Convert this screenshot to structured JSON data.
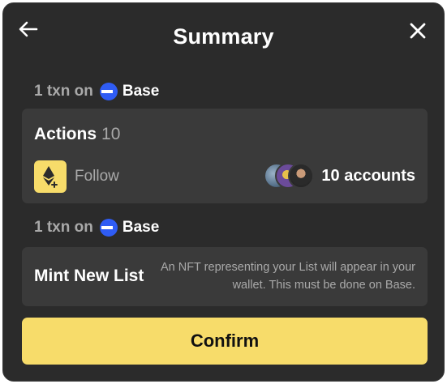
{
  "header": {
    "title": "Summary",
    "back_icon": "arrow-left-icon",
    "close_icon": "close-icon"
  },
  "transactions": [
    {
      "prefix": "1 txn on",
      "chain": "Base",
      "chain_icon": "base-chain-icon",
      "chain_color": "#2f5cf4"
    },
    {
      "prefix": "1 txn on",
      "chain": "Base",
      "chain_icon": "base-chain-icon",
      "chain_color": "#2f5cf4"
    }
  ],
  "actions_card": {
    "title": "Actions",
    "count": "10",
    "action": {
      "label": "Follow",
      "icon": "ethereum-plus-icon",
      "accounts": "10 accounts"
    }
  },
  "mint_card": {
    "title": "Mint New List",
    "description": "An NFT representing your List will appear in your wallet. This must be done on Base."
  },
  "confirm_button": {
    "label": "Confirm"
  },
  "colors": {
    "background": "#2b2b2b",
    "card": "#3a3a3a",
    "accent": "#f7dc6a",
    "muted_text": "#a9a9a9"
  }
}
